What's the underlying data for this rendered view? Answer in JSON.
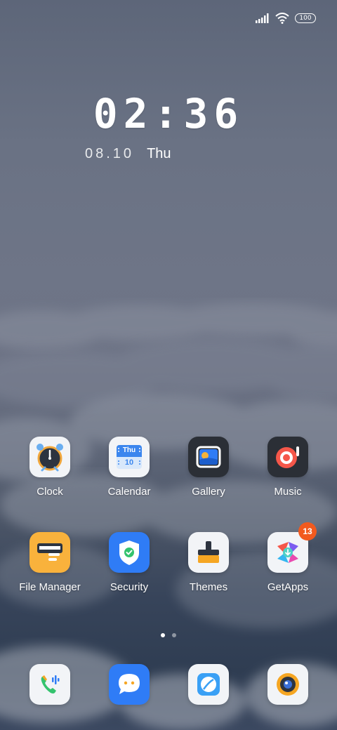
{
  "status": {
    "battery": "100",
    "signal_icon": "signal-icon",
    "wifi_icon": "wifi-icon"
  },
  "lockclock": {
    "time": "02:36",
    "date": "08.10",
    "weekday": "Thu"
  },
  "calendar_icon": {
    "day": "Thu",
    "date": "10"
  },
  "apps_row1": [
    {
      "label": "Clock",
      "icon": "alarm-clock-icon"
    },
    {
      "label": "Calendar",
      "icon": "calendar-icon"
    },
    {
      "label": "Gallery",
      "icon": "gallery-icon"
    },
    {
      "label": "Music",
      "icon": "music-icon"
    }
  ],
  "apps_row2": [
    {
      "label": "File Manager",
      "icon": "folder-icon"
    },
    {
      "label": "Security",
      "icon": "shield-icon"
    },
    {
      "label": "Themes",
      "icon": "brush-icon"
    },
    {
      "label": "GetApps",
      "icon": "getapps-icon",
      "badge": "13"
    }
  ],
  "dock": [
    {
      "icon": "phone-icon"
    },
    {
      "icon": "messages-icon"
    },
    {
      "icon": "browser-icon"
    },
    {
      "icon": "camera-icon"
    }
  ],
  "pager": {
    "pages": 2,
    "active": 0
  },
  "colors": {
    "badge": "#f25a1e",
    "security_blue": "#2f7cf6",
    "file_orange": "#f9b23c"
  }
}
